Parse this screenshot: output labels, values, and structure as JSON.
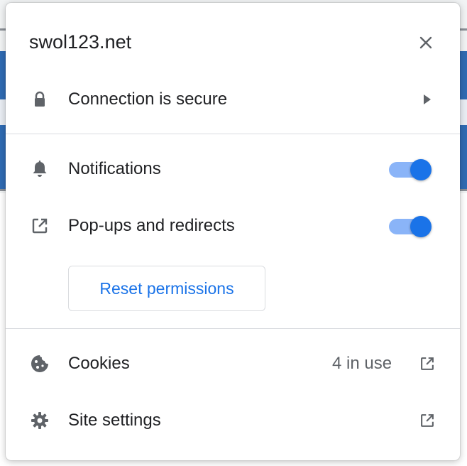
{
  "popup": {
    "site_title": "swol123.net",
    "connection": {
      "label": "Connection is secure",
      "icon": "lock-icon",
      "arrow": "triangle-right-icon"
    },
    "permissions": [
      {
        "label": "Notifications",
        "icon": "bell-icon",
        "enabled": true
      },
      {
        "label": "Pop-ups and redirects",
        "icon": "open-in-new-icon",
        "enabled": true
      }
    ],
    "reset_label": "Reset permissions",
    "cookies": {
      "label": "Cookies",
      "status": "4 in use",
      "icon": "cookie-icon",
      "action_icon": "open-in-new-icon"
    },
    "site_settings": {
      "label": "Site settings",
      "icon": "gear-icon",
      "action_icon": "open-in-new-icon"
    }
  },
  "colors": {
    "accent": "#1a73e8",
    "toggle_track": "#8ab4f8",
    "text": "#202124",
    "secondary_text": "#5f6368",
    "divider": "#dadce0"
  }
}
